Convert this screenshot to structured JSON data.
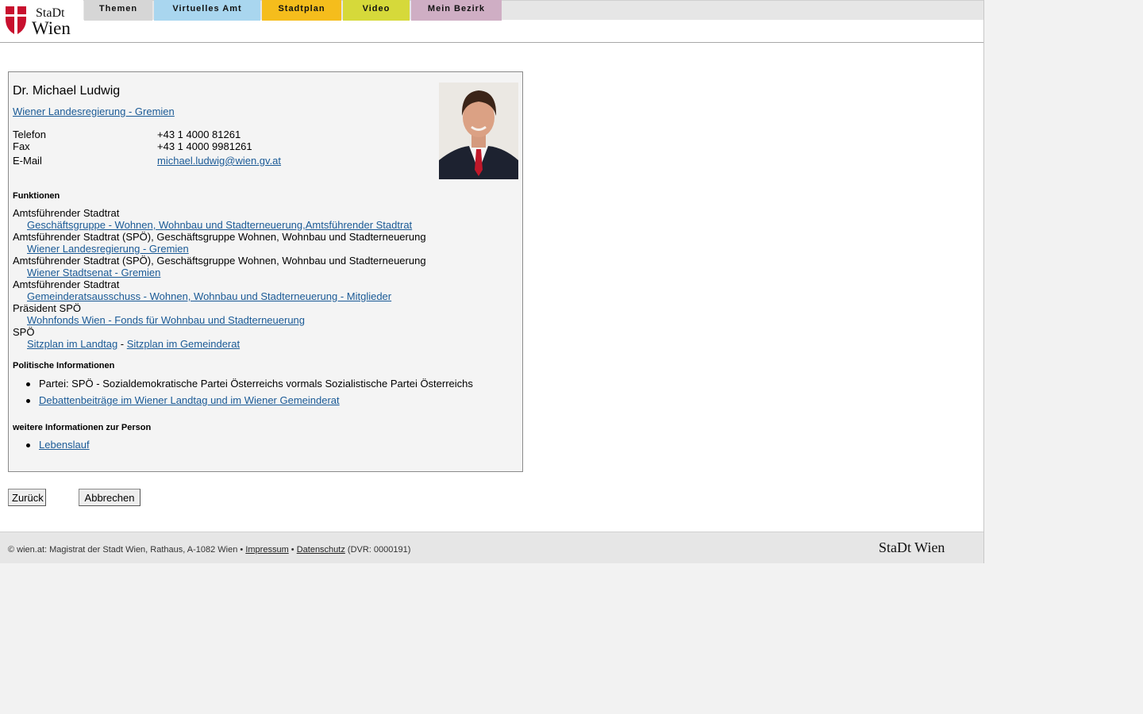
{
  "header": {
    "logo_text_top": "StaDt",
    "logo_text_bottom": "Wien",
    "tabs": [
      {
        "label": "Themen",
        "color": "#d6d6d6"
      },
      {
        "label": "Virtuelles Amt",
        "color": "#a9d6ef"
      },
      {
        "label": "Stadtplan",
        "color": "#f5bd1c"
      },
      {
        "label": "Video",
        "color": "#d6d93a"
      },
      {
        "label": "Mein Bezirk",
        "color": "#cfaec4"
      }
    ]
  },
  "person": {
    "name": "Dr. Michael Ludwig",
    "group_link": "Wiener Landesregierung - Gremien ",
    "contact": [
      {
        "label": "Telefon",
        "value": "+43 1 4000 81261"
      },
      {
        "label": "Fax",
        "value": "+43 1 4000 9981261"
      },
      {
        "label": "E-Mail",
        "value": "michael.ludwig@wien.gv.at"
      }
    ]
  },
  "functions": {
    "heading": "Funktionen",
    "items": [
      {
        "role": "Amtsführender Stadtrat",
        "links": [
          "Geschäftsgruppe - Wohnen, Wohnbau und Stadterneuerung,Amtsführender Stadtrat"
        ]
      },
      {
        "role": "Amtsführender Stadtrat (SPÖ), Geschäftsgruppe Wohnen, Wohnbau und Stadterneuerung",
        "links": [
          "Wiener Landesregierung - Gremien"
        ]
      },
      {
        "role": "Amtsführender Stadtrat (SPÖ), Geschäftsgruppe Wohnen, Wohnbau und Stadterneuerung",
        "links": [
          "Wiener Stadtsenat - Gremien"
        ]
      },
      {
        "role": "Amtsführender Stadtrat",
        "links": [
          "Gemeinderatsausschuss - Wohnen, Wohnbau und Stadterneuerung - Mitglieder"
        ]
      },
      {
        "role": "Präsident SPÖ",
        "links": [
          "Wohnfonds Wien - Fonds für Wohnbau und Stadterneuerung"
        ]
      },
      {
        "role": "SPÖ",
        "links": [
          "Sitzplan im Landtag",
          "Sitzplan im Gemeinderat"
        ],
        "separator": " - "
      }
    ]
  },
  "political": {
    "heading": "Politische Informationen",
    "party": "Partei: SPÖ - Sozialdemokratische Partei Österreichs vormals Sozialistische Partei Österreichs",
    "debate_link": "Debattenbeiträge im Wiener Landtag und im Wiener Gemeinderat"
  },
  "more": {
    "heading": "weitere Informationen zur Person",
    "cv_link": "Lebenslauf"
  },
  "buttons": {
    "back": "Zurück",
    "cancel": "Abbrechen"
  },
  "footer": {
    "text": "© wien.at: Magistrat der Stadt Wien, Rathaus, A-1082 Wien • ",
    "impressum": "Impressum",
    "sep": " • ",
    "datenschutz": "Datenschutz",
    "dvr": " (DVR: 0000191)",
    "logo_text": "StaDt Wien"
  }
}
